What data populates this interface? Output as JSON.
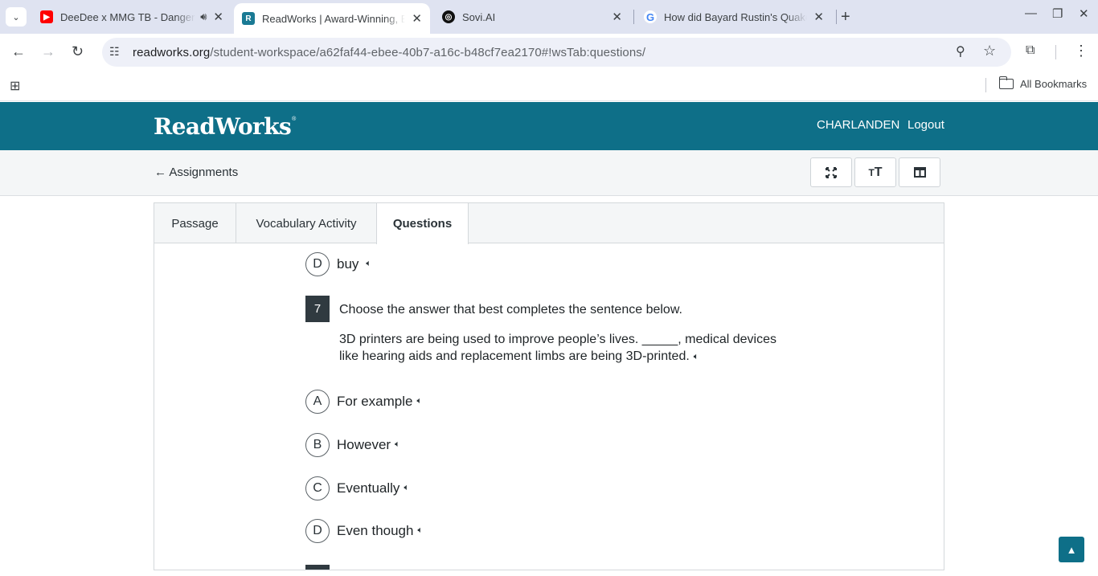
{
  "browser": {
    "tabs": [
      {
        "title": "DeeDee x MMG TB - Danger",
        "favicon": "youtube-icon",
        "color": "#ff0000",
        "playing_audio": true
      },
      {
        "title": "ReadWorks | Award-Winning, Ec",
        "favicon": "readworks-icon",
        "color": "#1a7a94",
        "active": true
      },
      {
        "title": "Sovi.AI",
        "favicon": "sovi-icon",
        "color": "#111111"
      },
      {
        "title": "How did Bayard Rustin's Quake",
        "favicon": "google-icon",
        "color": "#4285f4"
      }
    ],
    "url_host": "readworks.org",
    "url_path": "/student-workspace/a62faf44-ebee-40b7-a16c-b48cf7ea2170#!wsTab:questions/",
    "bookmarks_label": "All Bookmarks"
  },
  "header": {
    "logo": "ReadWorks",
    "logo_mark": "®",
    "username": "CHARLANDEN",
    "logout": "Logout",
    "brand_color": "#0e6f88"
  },
  "subbar": {
    "back_label": "← Assignments",
    "controls": [
      "fullscreen-icon",
      "text-size-icon",
      "split-view-icon"
    ]
  },
  "tabs": {
    "passage": "Passage",
    "vocabulary": "Vocabulary Activity",
    "questions": "Questions",
    "active": "Questions"
  },
  "prev_choice": {
    "letter": "D",
    "text": "buy"
  },
  "question": {
    "number": "7",
    "prompt": "Choose the answer that best completes the sentence below.",
    "sentence": "3D printers are being used to improve people’s lives. _____, medical devices like hearing aids and replacement limbs are being 3D-printed.",
    "choices": [
      {
        "letter": "A",
        "text": "For example"
      },
      {
        "letter": "B",
        "text": "However"
      },
      {
        "letter": "C",
        "text": "Eventually"
      },
      {
        "letter": "D",
        "text": "Even though"
      }
    ]
  },
  "scroll_top_label": "▲"
}
